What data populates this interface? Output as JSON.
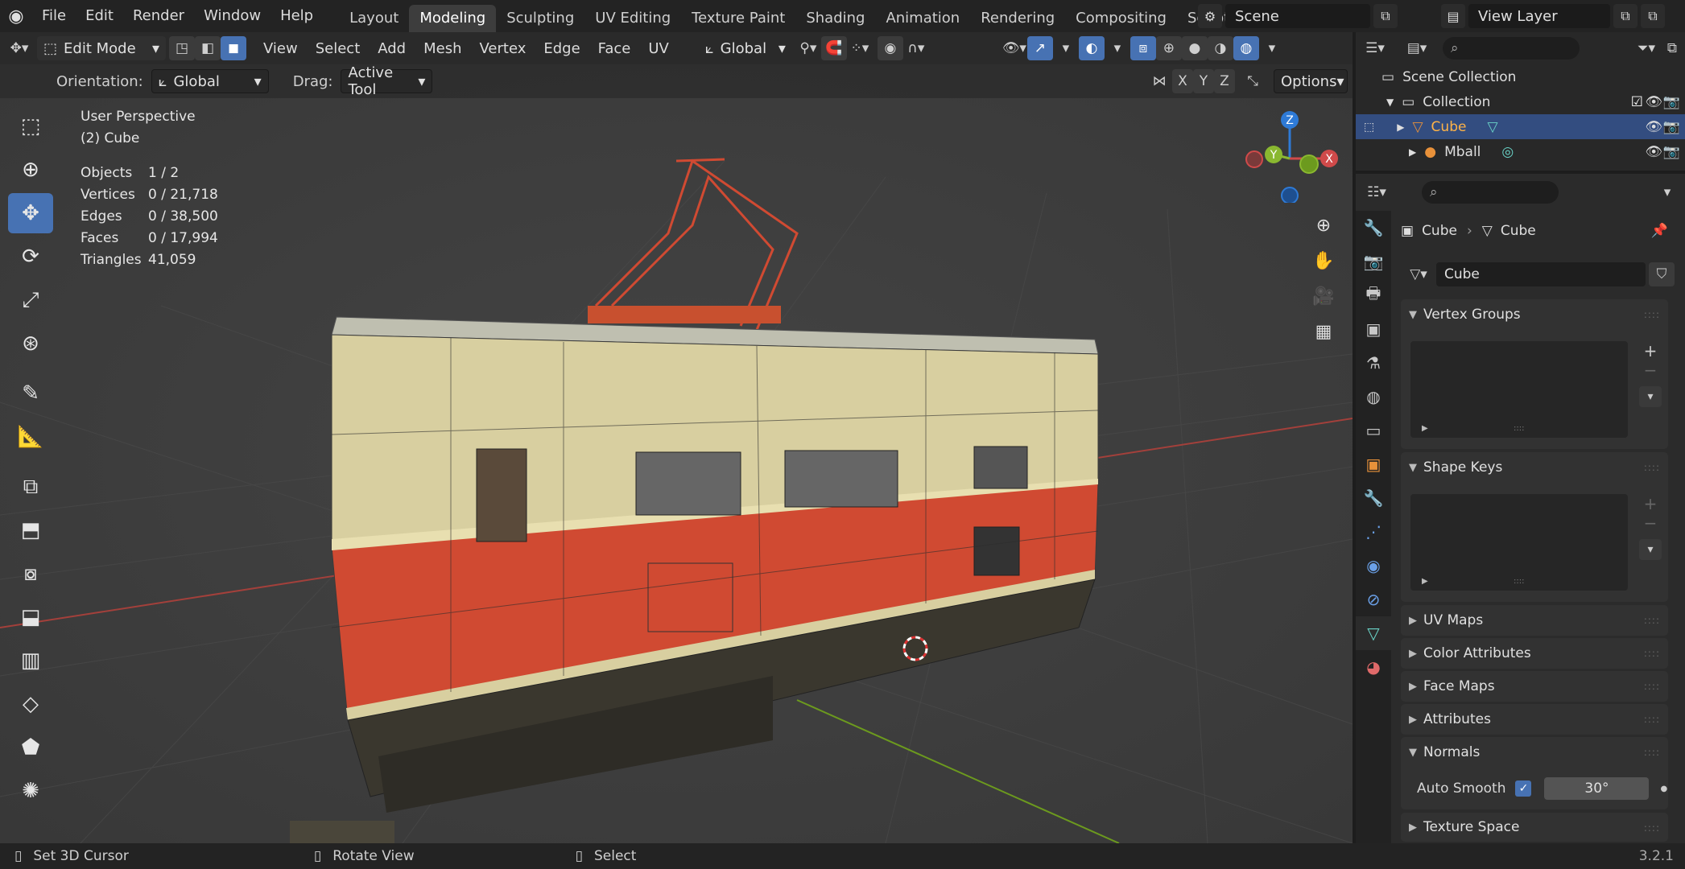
{
  "app": {
    "menus": [
      "File",
      "Edit",
      "Render",
      "Window",
      "Help"
    ],
    "workspaces": [
      "Layout",
      "Modeling",
      "Sculpting",
      "UV Editing",
      "Texture Paint",
      "Shading",
      "Animation",
      "Rendering",
      "Compositing",
      "Scripting"
    ],
    "active_workspace": "Modeling",
    "add_tab": "+",
    "scene": "Scene",
    "view_layer": "View Layer"
  },
  "header": {
    "mode": "Edit Mode",
    "menus": [
      "View",
      "Select",
      "Add",
      "Mesh",
      "Vertex",
      "Edge",
      "Face",
      "UV"
    ],
    "transform_space": "Global",
    "xyz": [
      "X",
      "Y",
      "Z"
    ],
    "options": "Options"
  },
  "toolsettings": {
    "orientation_label": "Orientation:",
    "orientation_value": "Global",
    "drag_label": "Drag:",
    "drag_value": "Active Tool"
  },
  "viewport": {
    "view_name": "User Perspective",
    "object_name": "(2) Cube",
    "stats": [
      {
        "key": "Objects",
        "value": "1 / 2"
      },
      {
        "key": "Vertices",
        "value": "0 / 21,718"
      },
      {
        "key": "Edges",
        "value": "0 / 38,500"
      },
      {
        "key": "Faces",
        "value": "0 / 17,994"
      },
      {
        "key": "Triangles",
        "value": "41,059"
      }
    ],
    "gizmo": {
      "z": "Z",
      "y": "Y",
      "x": "X"
    }
  },
  "outliner": {
    "root": "Scene Collection",
    "collection": "Collection",
    "items": [
      "Cube",
      "Mball"
    ]
  },
  "properties": {
    "breadcrumb": [
      "Cube",
      "Cube"
    ],
    "mesh_name": "Cube",
    "panels": {
      "vertex_groups": "Vertex Groups",
      "shape_keys": "Shape Keys",
      "uv_maps": "UV Maps",
      "color_attributes": "Color Attributes",
      "face_maps": "Face Maps",
      "attributes": "Attributes",
      "normals": "Normals",
      "texture_space": "Texture Space"
    },
    "auto_smooth_label": "Auto Smooth",
    "auto_smooth_angle": "30°"
  },
  "statusbar": {
    "hint1": "Set 3D Cursor",
    "hint2": "Rotate View",
    "hint3": "Select",
    "version": "3.2.1"
  },
  "colors": {
    "accent": "#4772b3",
    "active_tab": "#3d3d3d",
    "red_axis": "#b0403a",
    "green_axis": "#6c9a1e",
    "loco_cream": "#d8cfa0",
    "loco_red": "#d04a32"
  }
}
